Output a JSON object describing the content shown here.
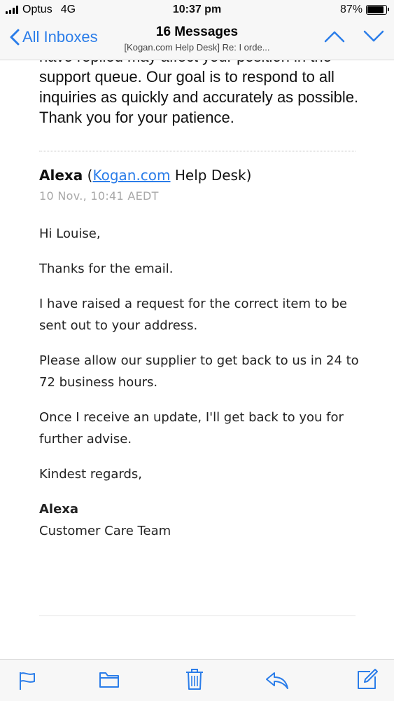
{
  "status_bar": {
    "carrier": "Optus",
    "network": "4G",
    "time": "10:37 pm",
    "battery": "87%",
    "battery_level": 0.87
  },
  "nav": {
    "back_label": "All Inboxes",
    "title": "16 Messages",
    "subtitle": "[Kogan.com Help Desk] Re: I orde..."
  },
  "prev_message": {
    "text": "have replied may affect your position in the support queue. Our goal is to respond to all inquiries as quickly and accurately as possible. Thank you for your patience."
  },
  "message": {
    "sender_name": "Alexa",
    "sender_org_link": "Kogan.com",
    "sender_org_suffix": "Help Desk",
    "date": "10 Nov., 10:41 AEDT",
    "greeting": "Hi Louise,",
    "p1": "Thanks for the email.",
    "p2": "I have raised a request for the correct item to be sent out to your address.",
    "p3": "Please allow our supplier to get back to us in 24 to 72 business hours.",
    "p4": "Once I receive an update, I'll get back to you for further advise.",
    "closing": "Kindest regards,",
    "signature_name": "Alexa",
    "signature_team": "Customer Care Team"
  },
  "toolbar": {
    "icons": [
      "flag-icon",
      "folder-icon",
      "trash-icon",
      "reply-icon",
      "compose-icon"
    ]
  },
  "colors": {
    "accent": "#2b7de9",
    "muted": "#a8a8a8"
  }
}
